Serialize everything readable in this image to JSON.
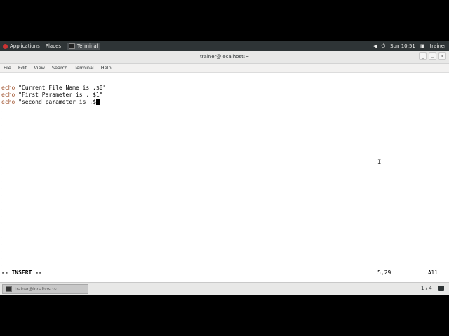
{
  "topbar": {
    "applications": "Applications",
    "places": "Places",
    "terminal_task": "Terminal",
    "clock": "Sun 10:51",
    "user": "trainer"
  },
  "window": {
    "title": "trainer@localhost:~"
  },
  "menubar": {
    "items": [
      "File",
      "Edit",
      "View",
      "Search",
      "Terminal",
      "Help"
    ]
  },
  "editor": {
    "lines": [
      {
        "kw": "echo",
        "rest": " \"Current File Name is ,$0\""
      },
      {
        "kw": "echo",
        "rest": " \"First Parameter is , $1\""
      },
      {
        "kw": "echo",
        "rest": " \"second parameter is ,$"
      }
    ],
    "tilde": "~",
    "mode": "-- INSERT --",
    "position": "5,29",
    "scroll": "All"
  },
  "bottombar": {
    "task": "trainer@localhost:~",
    "workspace": "1 / 4"
  }
}
